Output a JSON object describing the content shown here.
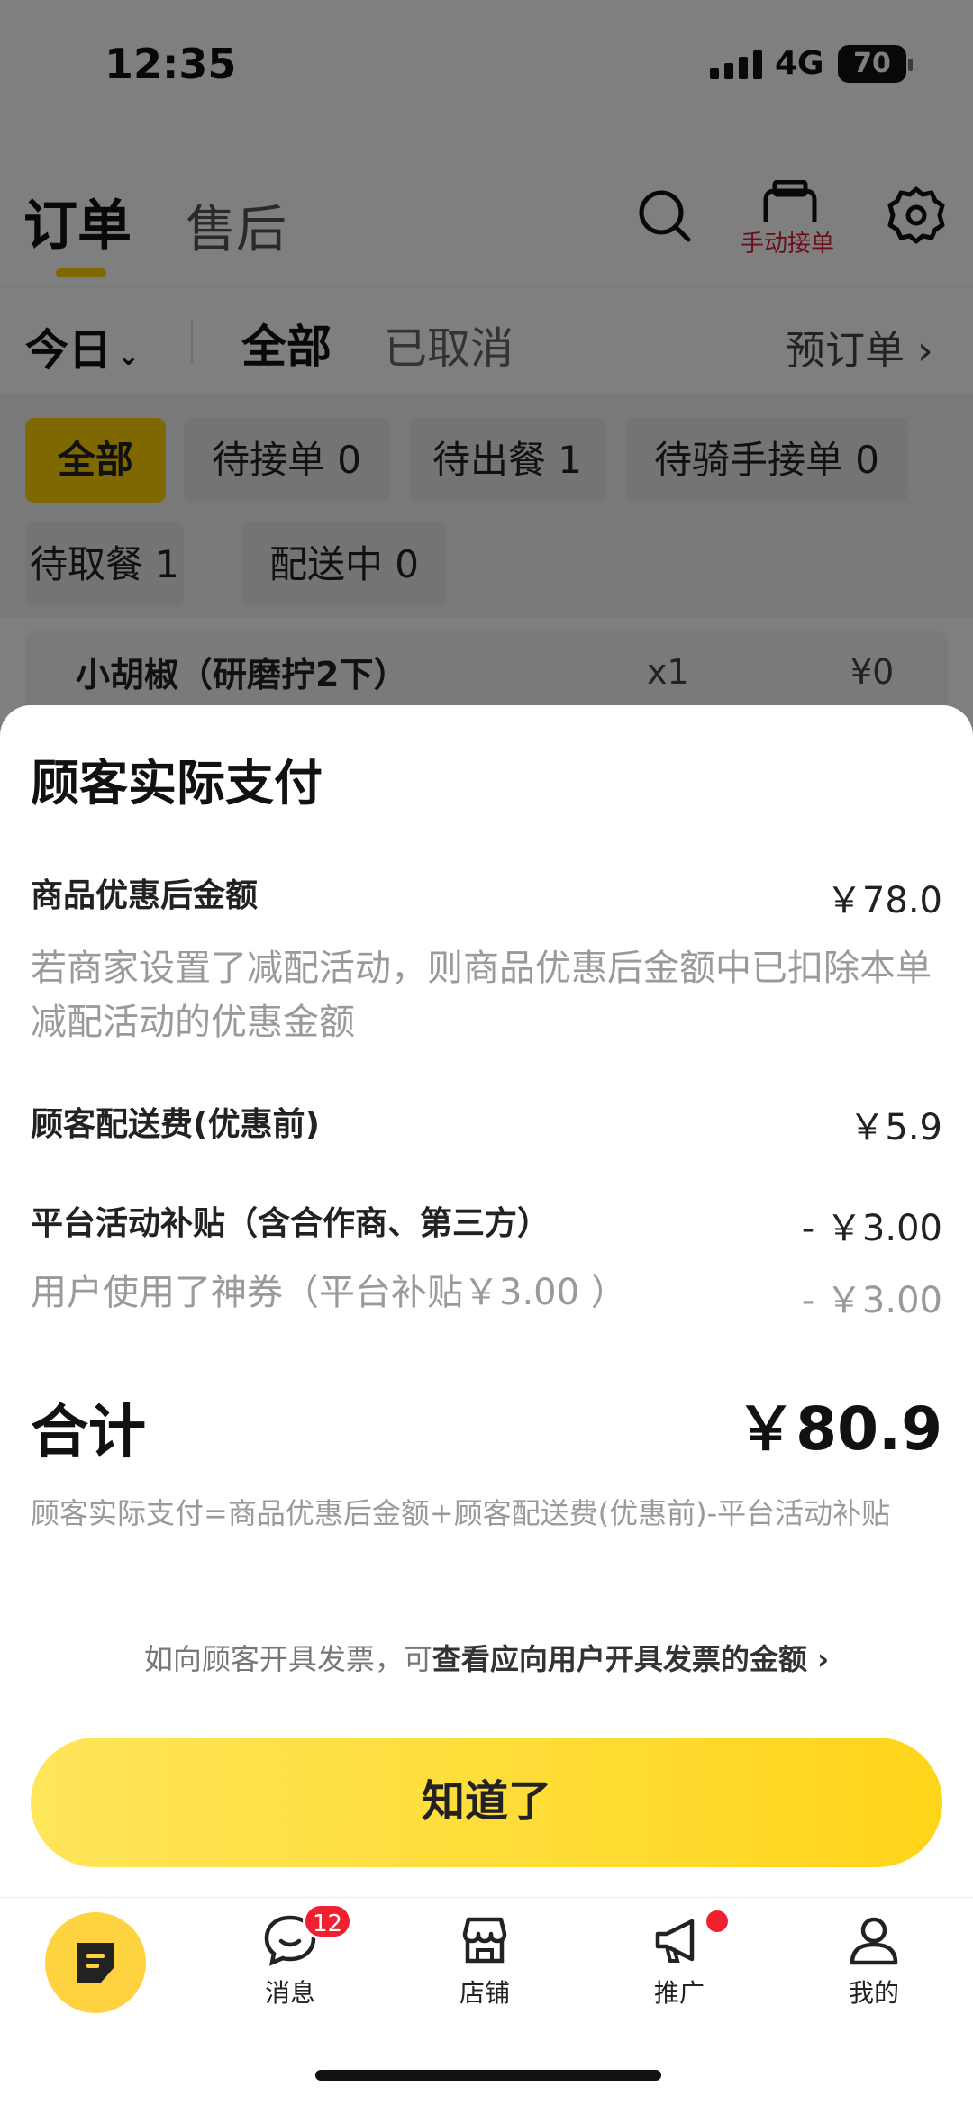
{
  "status_bar": {
    "time": "12:35",
    "network": "4G",
    "battery": "70"
  },
  "header": {
    "tabs": [
      {
        "label": "订单"
      },
      {
        "label": "售后"
      }
    ],
    "manual_accept_label": "手动接单"
  },
  "filter_bar": {
    "date_label": "今日",
    "tabs": [
      {
        "label": "全部"
      },
      {
        "label": "已取消"
      }
    ],
    "preorder_label": "预订单"
  },
  "status_chips": [
    {
      "label": "全部"
    },
    {
      "label": "待接单 0"
    },
    {
      "label": "待出餐 1"
    },
    {
      "label": "待骑手接单 0"
    },
    {
      "label": "待取餐 1"
    },
    {
      "label": "配送中 0"
    }
  ],
  "order_item": {
    "name": "小胡椒（研磨拧2下）",
    "qty": "x1",
    "price": "¥0"
  },
  "sheet": {
    "title": "顾客实际支付",
    "rows": [
      {
        "label": "商品优惠后金额",
        "value": "￥78.0",
        "note": "若商家设置了减配活动，则商品优惠后金额中已扣除本单减配活动的优惠金额"
      },
      {
        "label": "顾客配送费(优惠前)",
        "value": "￥5.9"
      },
      {
        "label": "平台活动补贴（含合作商、第三方）",
        "value": "- ￥3.00",
        "sub_label": "用户使用了神券（平台补贴￥3.00 ）",
        "sub_value": "- ￥3.00"
      }
    ],
    "total_label": "合计",
    "total_value": "￥80.9",
    "formula": "顾客实际支付=商品优惠后金额+顾客配送费(优惠前)-平台活动补贴",
    "invoice_prefix": "如向顾客开具发票，可",
    "invoice_link": "查看应向用户开具发票的金额",
    "confirm_label": "知道了"
  },
  "bottom_nav": {
    "items": [
      {
        "label": "消息",
        "badge": "12"
      },
      {
        "label": "店铺"
      },
      {
        "label": "推广"
      },
      {
        "label": "我的"
      }
    ]
  },
  "colors": {
    "brand_yellow": "#ffd100",
    "badge_red": "#f02030"
  }
}
